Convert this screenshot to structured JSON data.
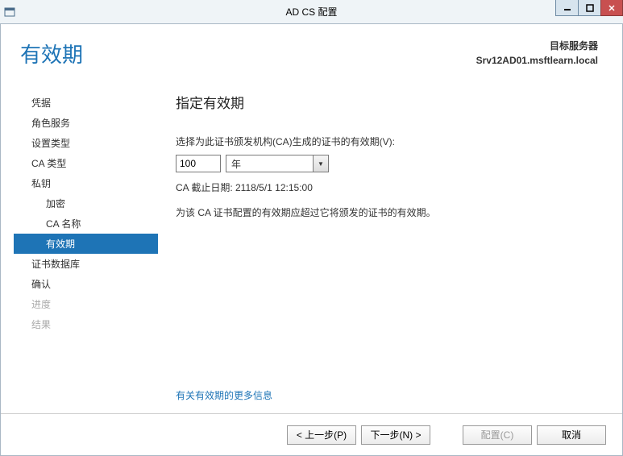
{
  "titlebar": {
    "title": "AD CS 配置"
  },
  "header": {
    "page_title": "有效期",
    "target_label": "目标服务器",
    "target_value": "Srv12AD01.msftlearn.local"
  },
  "sidebar": {
    "items": [
      {
        "label": "凭据",
        "sub": false,
        "selected": false,
        "disabled": false
      },
      {
        "label": "角色服务",
        "sub": false,
        "selected": false,
        "disabled": false
      },
      {
        "label": "设置类型",
        "sub": false,
        "selected": false,
        "disabled": false
      },
      {
        "label": "CA 类型",
        "sub": false,
        "selected": false,
        "disabled": false
      },
      {
        "label": "私钥",
        "sub": false,
        "selected": false,
        "disabled": false
      },
      {
        "label": "加密",
        "sub": true,
        "selected": false,
        "disabled": false
      },
      {
        "label": "CA 名称",
        "sub": true,
        "selected": false,
        "disabled": false
      },
      {
        "label": "有效期",
        "sub": true,
        "selected": true,
        "disabled": false
      },
      {
        "label": "证书数据库",
        "sub": false,
        "selected": false,
        "disabled": false
      },
      {
        "label": "确认",
        "sub": false,
        "selected": false,
        "disabled": false
      },
      {
        "label": "进度",
        "sub": false,
        "selected": false,
        "disabled": true
      },
      {
        "label": "结果",
        "sub": false,
        "selected": false,
        "disabled": true
      }
    ]
  },
  "main": {
    "heading": "指定有效期",
    "choose_label": "选择为此证书颁发机构(CA)生成的证书的有效期(V):",
    "value": "100",
    "unit": "年",
    "expiration_line": "CA 截止日期: 2118/5/1 12:15:00",
    "note_line": "为该 CA 证书配置的有效期应超过它将颁发的证书的有效期。",
    "more_link": "有关有效期的更多信息"
  },
  "footer": {
    "prev": "< 上一步(P)",
    "next": "下一步(N) >",
    "configure": "配置(C)",
    "cancel": "取消"
  }
}
